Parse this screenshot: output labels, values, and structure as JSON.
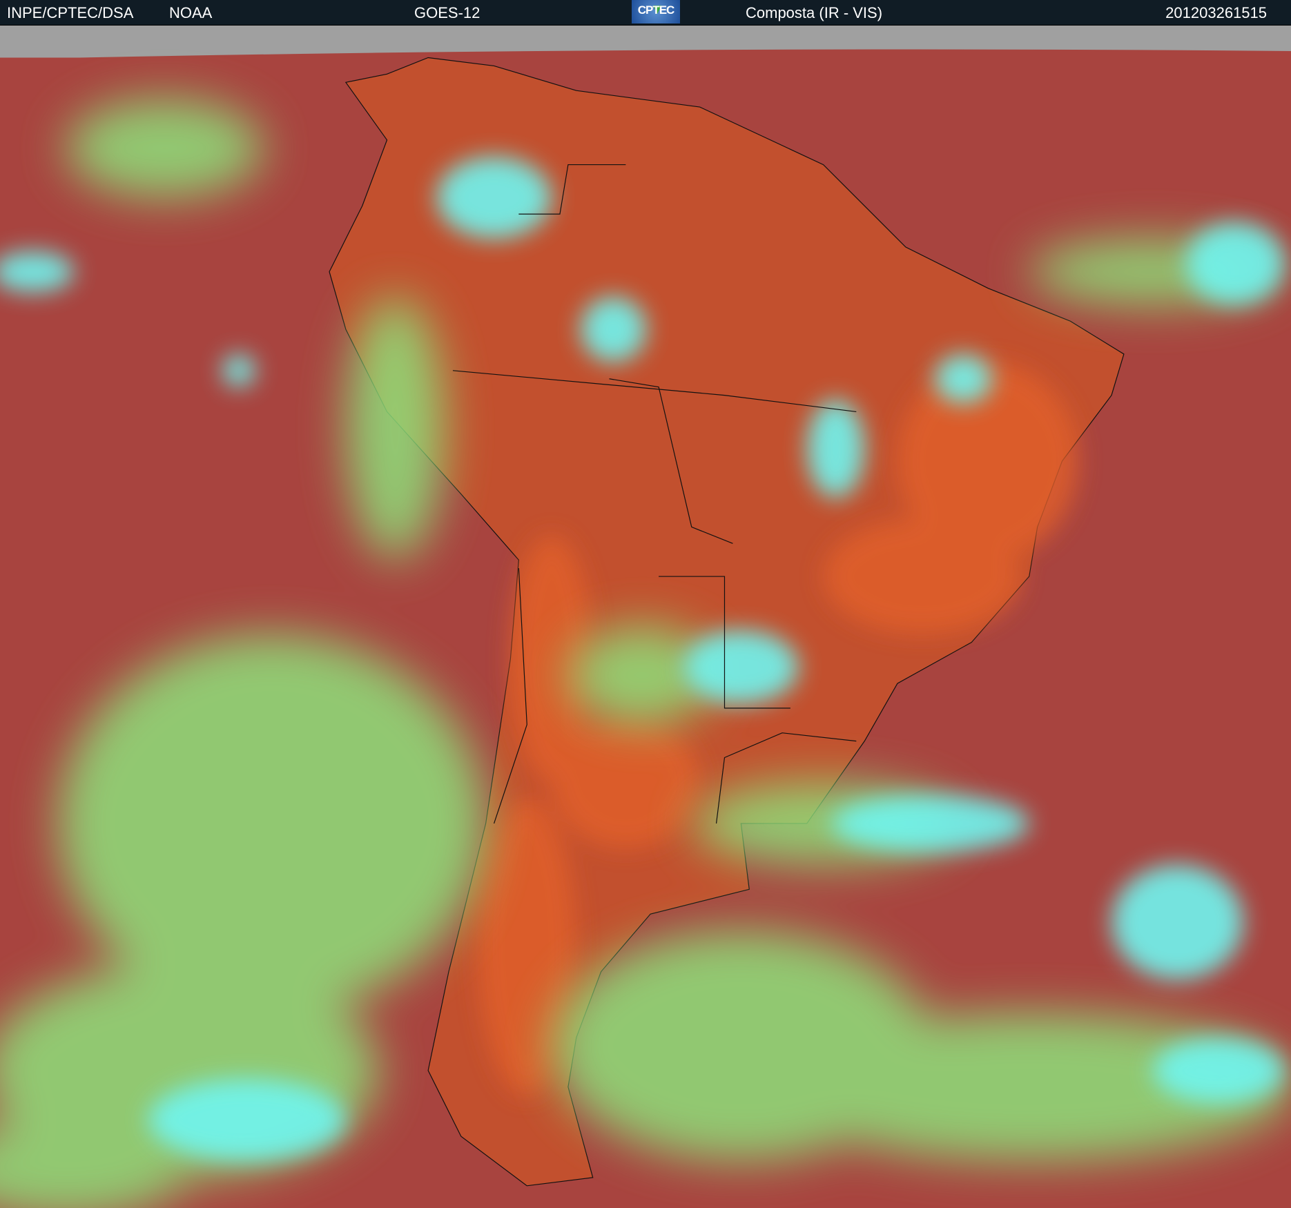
{
  "header": {
    "agency": "INPE/CPTEC/DSA",
    "source": "NOAA",
    "satellite": "GOES-12",
    "logo_text": "CPTEC",
    "product": "Composta (IR - VIS)",
    "timestamp": "201203261515"
  },
  "colors": {
    "header_bg": "#101c25",
    "ocean_clear": "#a8443f",
    "land_clear": "#d85a2a",
    "low_cloud": "#8ee07a",
    "high_cloud": "#6ff5f0",
    "no_data": "#a0a0a0"
  }
}
